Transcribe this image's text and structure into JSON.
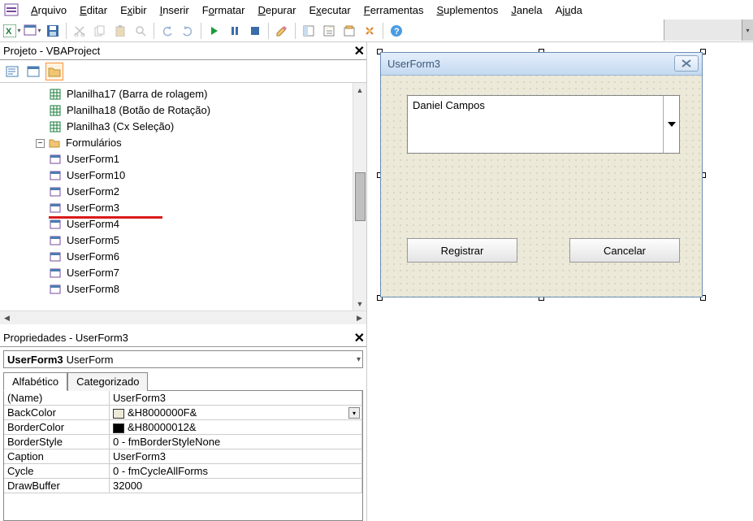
{
  "menubar": [
    "Arquivo",
    "Editar",
    "Exibir",
    "Inserir",
    "Formatar",
    "Depurar",
    "Executar",
    "Ferramentas",
    "Suplementos",
    "Janela",
    "Ajuda"
  ],
  "projectPanel": {
    "title": "Projeto - VBAProject",
    "tree": {
      "items": [
        {
          "label": "Planilha17 (Barra de rolagem)",
          "type": "sheet"
        },
        {
          "label": "Planilha18 (Botão de Rotação)",
          "type": "sheet"
        },
        {
          "label": "Planilha3 (Cx Seleção)",
          "type": "sheet"
        }
      ],
      "folderLabel": "Formulários",
      "forms": [
        "UserForm1",
        "UserForm10",
        "UserForm2",
        "UserForm3",
        "UserForm4",
        "UserForm5",
        "UserForm6",
        "UserForm7",
        "UserForm8"
      ]
    }
  },
  "propsPanel": {
    "title": "Propriedades - UserForm3",
    "objectName": "UserForm3",
    "objectType": "UserForm",
    "tabs": [
      "Alfabético",
      "Categorizado"
    ],
    "rows": [
      {
        "name": "(Name)",
        "value": "UserForm3"
      },
      {
        "name": "BackColor",
        "value": "&H8000000F&",
        "swatch": "#ece9d8",
        "dd": true
      },
      {
        "name": "BorderColor",
        "value": "&H80000012&",
        "swatch": "#000000"
      },
      {
        "name": "BorderStyle",
        "value": "0 - fmBorderStyleNone"
      },
      {
        "name": "Caption",
        "value": "UserForm3"
      },
      {
        "name": "Cycle",
        "value": "0 - fmCycleAllForms"
      },
      {
        "name": "DrawBuffer",
        "value": "32000"
      }
    ]
  },
  "userform": {
    "caption": "UserForm3",
    "comboValue": "Daniel Campos",
    "btn1": "Registrar",
    "btn2": "Cancelar"
  }
}
